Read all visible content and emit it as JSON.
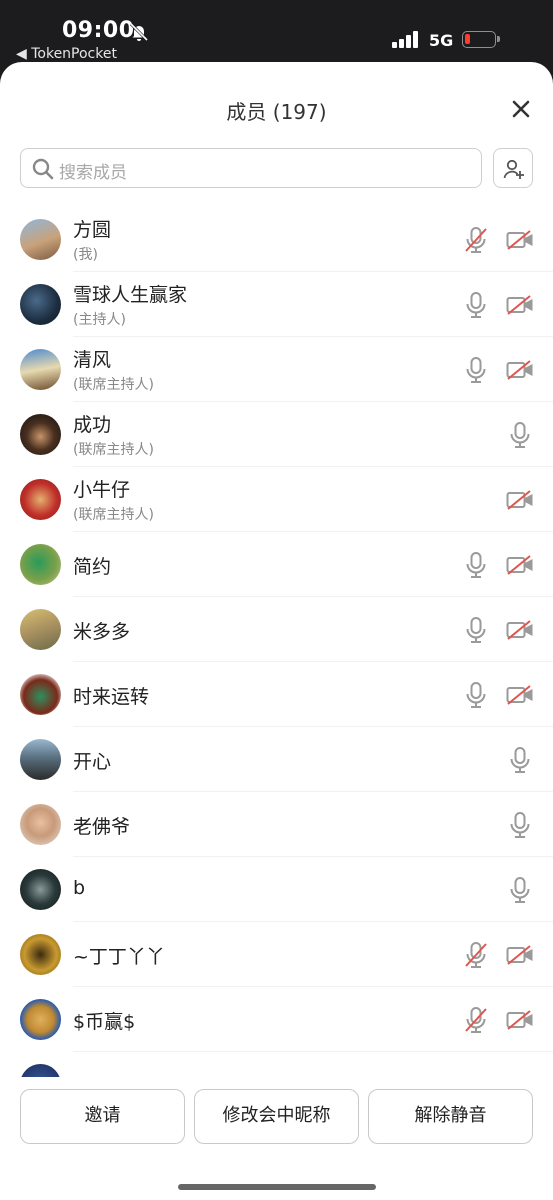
{
  "status_bar": {
    "time": "09:00",
    "back_app": "◀ TokenPocket",
    "network": "5G",
    "battery_color": "#ff3b30"
  },
  "header": {
    "title": "成员 (197)"
  },
  "search": {
    "placeholder": "搜索成员"
  },
  "members": [
    {
      "name": "方圆",
      "role": "(我)",
      "mic": "muted",
      "camera": "off"
    },
    {
      "name": "雪球人生赢家",
      "role": "(主持人)",
      "mic": "on",
      "camera": "off"
    },
    {
      "name": "清风",
      "role": "(联席主持人)",
      "mic": "on",
      "camera": "off"
    },
    {
      "name": "成功",
      "role": "(联席主持人)",
      "mic": "on",
      "camera": "none"
    },
    {
      "name": "小牛仔",
      "role": "(联席主持人)",
      "mic": "none",
      "camera": "off"
    },
    {
      "name": "简约",
      "role": "",
      "mic": "on",
      "camera": "off"
    },
    {
      "name": "米多多",
      "role": "",
      "mic": "on",
      "camera": "off"
    },
    {
      "name": "时来运转",
      "role": "",
      "mic": "on",
      "camera": "off"
    },
    {
      "name": "开心",
      "role": "",
      "mic": "on",
      "camera": "none"
    },
    {
      "name": "老佛爷",
      "role": "",
      "mic": "on",
      "camera": "none"
    },
    {
      "name": "b",
      "role": "",
      "mic": "on",
      "camera": "none"
    },
    {
      "name": "~丁丁丫丫",
      "role": "",
      "mic": "muted",
      "camera": "off"
    },
    {
      "name": "$币赢$",
      "role": "",
      "mic": "muted",
      "camera": "off"
    }
  ],
  "actions": {
    "invite": "邀请",
    "rename": "修改会中昵称",
    "unmute": "解除静音"
  },
  "colors": {
    "icon_gray": "#9a9a9a",
    "muted_red": "#e0554d"
  }
}
